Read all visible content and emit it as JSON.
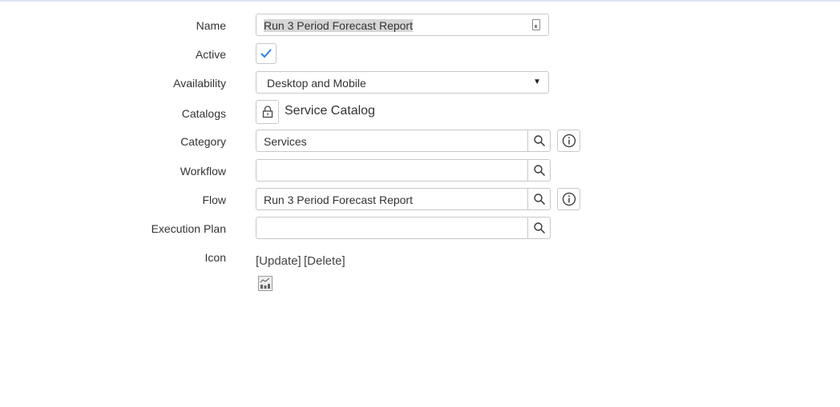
{
  "form": {
    "name": {
      "label": "Name",
      "value": "Run 3 Period Forecast Report"
    },
    "active": {
      "label": "Active",
      "checked": true
    },
    "availability": {
      "label": "Availability",
      "value": "Desktop and Mobile"
    },
    "catalogs": {
      "label": "Catalogs",
      "value": "Service Catalog"
    },
    "category": {
      "label": "Category",
      "value": "Services"
    },
    "workflow": {
      "label": "Workflow",
      "value": ""
    },
    "flow": {
      "label": "Flow",
      "value": "Run 3 Period Forecast Report"
    },
    "execution_plan": {
      "label": "Execution Plan",
      "value": ""
    },
    "icon": {
      "label": "Icon",
      "update": "[Update]",
      "delete": "[Delete]"
    }
  },
  "colors": {
    "accent": "#2f7fd9",
    "border": "#c8c8c8"
  }
}
